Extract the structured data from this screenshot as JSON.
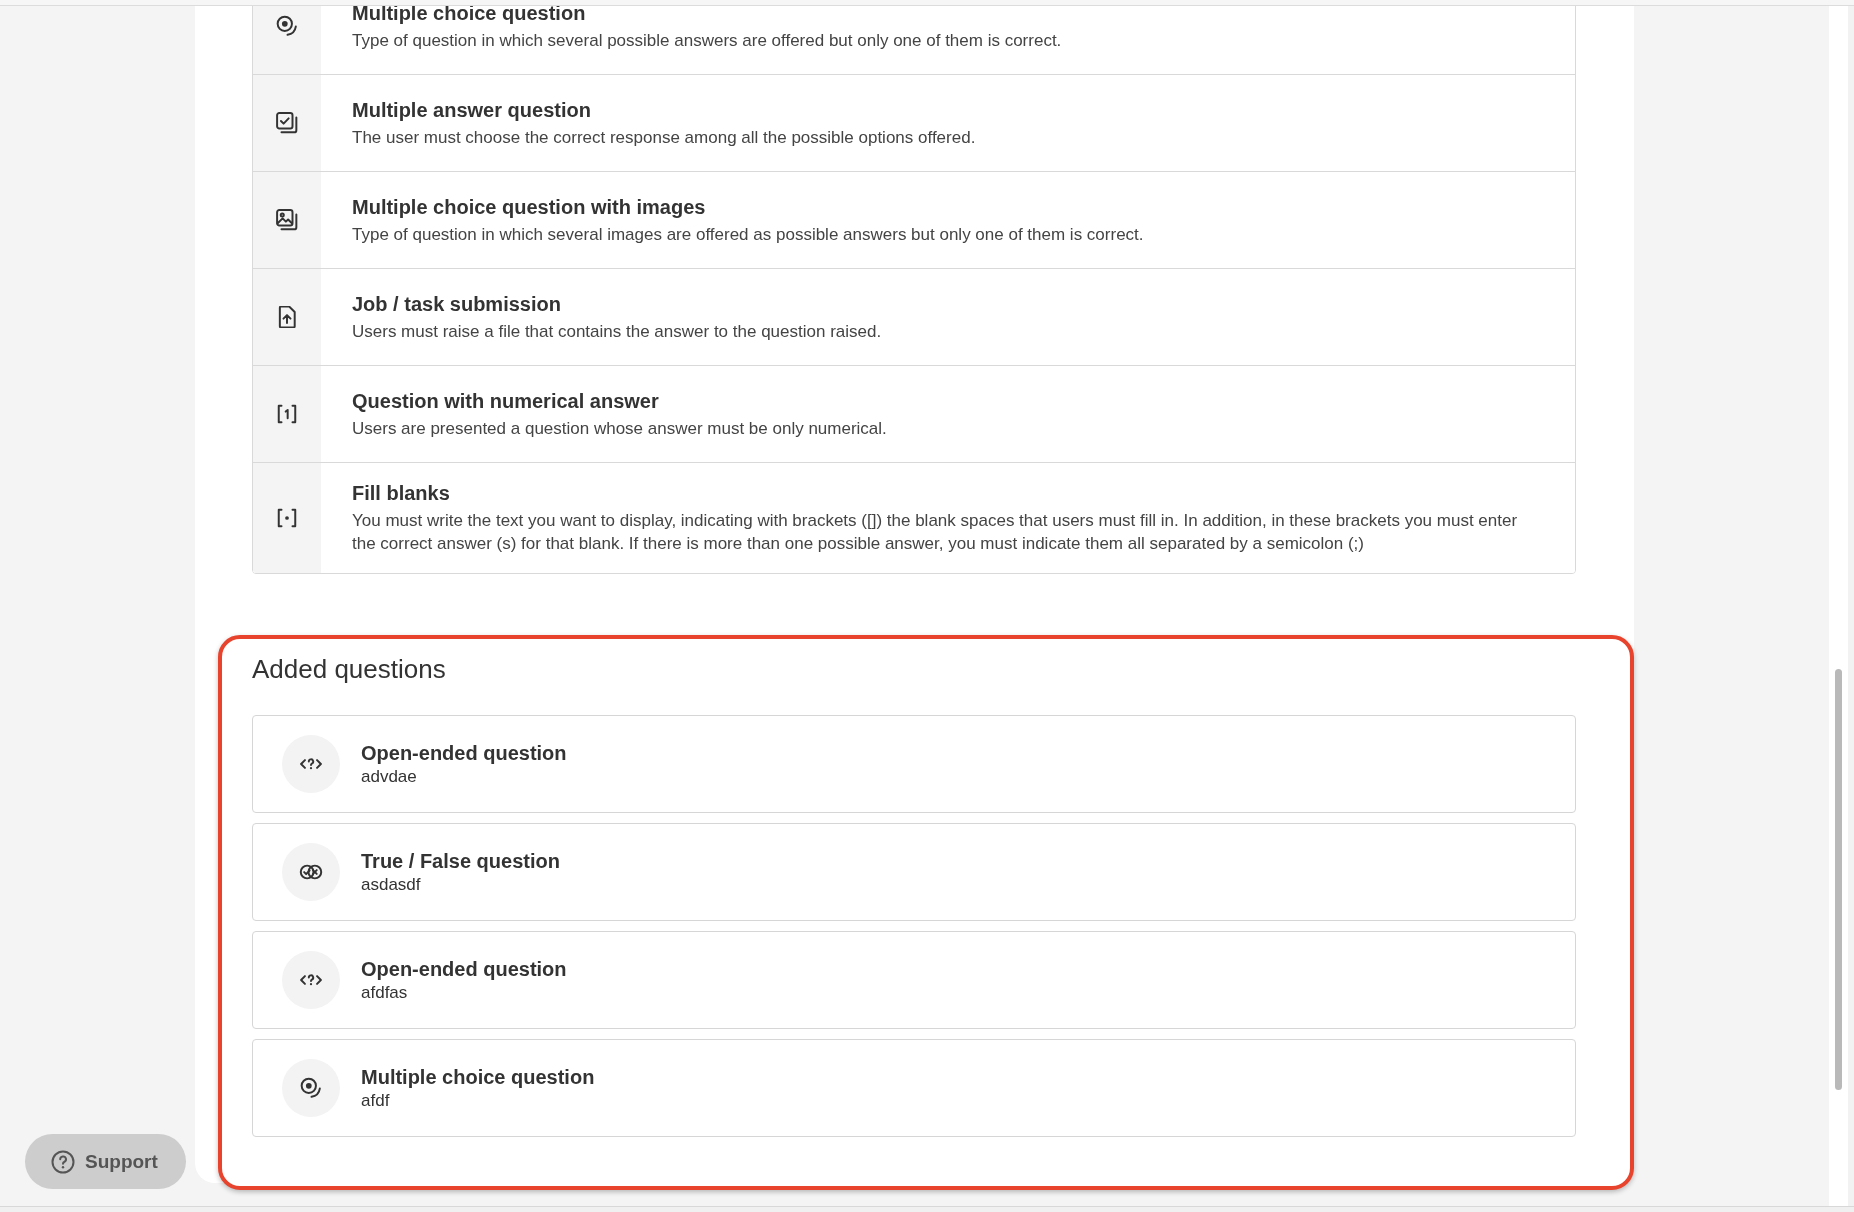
{
  "question_types": [
    {
      "kind": "multiple_choice",
      "title": "Multiple choice question",
      "description": "Type of question in which several possible answers are offered but only one of them is correct."
    },
    {
      "kind": "multiple_answer",
      "title": "Multiple answer question",
      "description": "The user must choose the correct response among all the possible options offered."
    },
    {
      "kind": "image_choice",
      "title": "Multiple choice question with images",
      "description": "Type of question in which several images are offered as possible answers but only one of them is correct."
    },
    {
      "kind": "file_submission",
      "title": "Job / task submission",
      "description": "Users must raise a file that contains the answer to the question raised."
    },
    {
      "kind": "numerical",
      "title": "Question with numerical answer",
      "description": "Users are presented a question whose answer must be only numerical."
    },
    {
      "kind": "fill_blanks",
      "title": "Fill blanks",
      "description": "You must write the text you want to display, indicating with brackets ([]) the blank spaces that users must fill in. In addition, in these brackets you must enter the correct answer (s) for that blank. If there is more than one possible answer, you must indicate them all separated by a semicolon (;)"
    }
  ],
  "added_questions": {
    "title": "Added questions",
    "highlighted": true,
    "items": [
      {
        "kind": "open_ended",
        "title": "Open-ended question",
        "name": "advdae"
      },
      {
        "kind": "true_false",
        "title": "True / False question",
        "name": "asdasdf"
      },
      {
        "kind": "open_ended",
        "title": "Open-ended question",
        "name": "afdfas"
      },
      {
        "kind": "multiple_choice",
        "title": "Multiple choice question",
        "name": "afdf"
      }
    ]
  },
  "support_button": {
    "label": "Support"
  }
}
